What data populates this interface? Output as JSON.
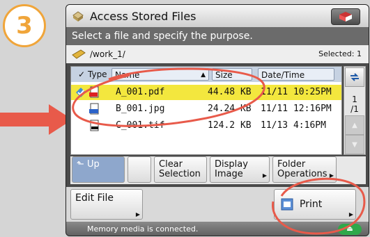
{
  "step_number": "3",
  "colors": {
    "accent_orange": "#f0a53a",
    "annotation_red": "#e85a4a",
    "selected_row": "#f3e73e",
    "header_blue": "#c6d2e2",
    "up_button_blue": "#8ea7cc",
    "eject_green": "#2fa84a"
  },
  "window": {
    "title": "Access Stored Files"
  },
  "instruction": "Select a file and specify the purpose.",
  "path": {
    "text": "/work_1/",
    "selected_label": "Selected: 1"
  },
  "columns": {
    "check": "✓",
    "type": "Type",
    "name": "Name",
    "size": "Size",
    "date": "Date/Time"
  },
  "files": [
    {
      "name": "A_001.pdf",
      "size": "44.48 KB",
      "date": "11/11 10:25PM",
      "icon": "pdf-file-icon",
      "badge": "PDF",
      "selected": true
    },
    {
      "name": "B_001.jpg",
      "size": "24.24 KB",
      "date": "11/11 12:16PM",
      "icon": "jpeg-file-icon",
      "badge": "JPEG",
      "selected": false
    },
    {
      "name": "C_001.tif",
      "size": "124.2 KB",
      "date": "11/13 4:16PM",
      "icon": "tiff-file-icon",
      "badge": "",
      "selected": false
    }
  ],
  "pager": {
    "current": "1",
    "total": "/1"
  },
  "buttons": {
    "up": "Up",
    "clear_selection_line1": "Clear",
    "clear_selection_line2": "Selection",
    "display_image_line1": "Display",
    "display_image_line2": "Image",
    "folder_ops_line1": "Folder",
    "folder_ops_line2": "Operations",
    "edit_file": "Edit File",
    "print": "Print"
  },
  "status": {
    "text": "Memory media is connected."
  }
}
